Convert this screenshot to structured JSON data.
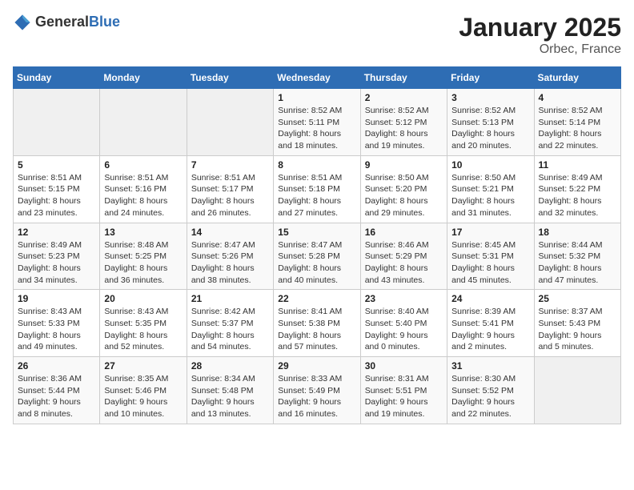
{
  "header": {
    "logo": {
      "general": "General",
      "blue": "Blue"
    },
    "title": "January 2025",
    "subtitle": "Orbec, France"
  },
  "calendar": {
    "days_of_week": [
      "Sunday",
      "Monday",
      "Tuesday",
      "Wednesday",
      "Thursday",
      "Friday",
      "Saturday"
    ],
    "weeks": [
      [
        {
          "day": "",
          "info": ""
        },
        {
          "day": "",
          "info": ""
        },
        {
          "day": "",
          "info": ""
        },
        {
          "day": "1",
          "info": "Sunrise: 8:52 AM\nSunset: 5:11 PM\nDaylight: 8 hours and 18 minutes."
        },
        {
          "day": "2",
          "info": "Sunrise: 8:52 AM\nSunset: 5:12 PM\nDaylight: 8 hours and 19 minutes."
        },
        {
          "day": "3",
          "info": "Sunrise: 8:52 AM\nSunset: 5:13 PM\nDaylight: 8 hours and 20 minutes."
        },
        {
          "day": "4",
          "info": "Sunrise: 8:52 AM\nSunset: 5:14 PM\nDaylight: 8 hours and 22 minutes."
        }
      ],
      [
        {
          "day": "5",
          "info": "Sunrise: 8:51 AM\nSunset: 5:15 PM\nDaylight: 8 hours and 23 minutes."
        },
        {
          "day": "6",
          "info": "Sunrise: 8:51 AM\nSunset: 5:16 PM\nDaylight: 8 hours and 24 minutes."
        },
        {
          "day": "7",
          "info": "Sunrise: 8:51 AM\nSunset: 5:17 PM\nDaylight: 8 hours and 26 minutes."
        },
        {
          "day": "8",
          "info": "Sunrise: 8:51 AM\nSunset: 5:18 PM\nDaylight: 8 hours and 27 minutes."
        },
        {
          "day": "9",
          "info": "Sunrise: 8:50 AM\nSunset: 5:20 PM\nDaylight: 8 hours and 29 minutes."
        },
        {
          "day": "10",
          "info": "Sunrise: 8:50 AM\nSunset: 5:21 PM\nDaylight: 8 hours and 31 minutes."
        },
        {
          "day": "11",
          "info": "Sunrise: 8:49 AM\nSunset: 5:22 PM\nDaylight: 8 hours and 32 minutes."
        }
      ],
      [
        {
          "day": "12",
          "info": "Sunrise: 8:49 AM\nSunset: 5:23 PM\nDaylight: 8 hours and 34 minutes."
        },
        {
          "day": "13",
          "info": "Sunrise: 8:48 AM\nSunset: 5:25 PM\nDaylight: 8 hours and 36 minutes."
        },
        {
          "day": "14",
          "info": "Sunrise: 8:47 AM\nSunset: 5:26 PM\nDaylight: 8 hours and 38 minutes."
        },
        {
          "day": "15",
          "info": "Sunrise: 8:47 AM\nSunset: 5:28 PM\nDaylight: 8 hours and 40 minutes."
        },
        {
          "day": "16",
          "info": "Sunrise: 8:46 AM\nSunset: 5:29 PM\nDaylight: 8 hours and 43 minutes."
        },
        {
          "day": "17",
          "info": "Sunrise: 8:45 AM\nSunset: 5:31 PM\nDaylight: 8 hours and 45 minutes."
        },
        {
          "day": "18",
          "info": "Sunrise: 8:44 AM\nSunset: 5:32 PM\nDaylight: 8 hours and 47 minutes."
        }
      ],
      [
        {
          "day": "19",
          "info": "Sunrise: 8:43 AM\nSunset: 5:33 PM\nDaylight: 8 hours and 49 minutes."
        },
        {
          "day": "20",
          "info": "Sunrise: 8:43 AM\nSunset: 5:35 PM\nDaylight: 8 hours and 52 minutes."
        },
        {
          "day": "21",
          "info": "Sunrise: 8:42 AM\nSunset: 5:37 PM\nDaylight: 8 hours and 54 minutes."
        },
        {
          "day": "22",
          "info": "Sunrise: 8:41 AM\nSunset: 5:38 PM\nDaylight: 8 hours and 57 minutes."
        },
        {
          "day": "23",
          "info": "Sunrise: 8:40 AM\nSunset: 5:40 PM\nDaylight: 9 hours and 0 minutes."
        },
        {
          "day": "24",
          "info": "Sunrise: 8:39 AM\nSunset: 5:41 PM\nDaylight: 9 hours and 2 minutes."
        },
        {
          "day": "25",
          "info": "Sunrise: 8:37 AM\nSunset: 5:43 PM\nDaylight: 9 hours and 5 minutes."
        }
      ],
      [
        {
          "day": "26",
          "info": "Sunrise: 8:36 AM\nSunset: 5:44 PM\nDaylight: 9 hours and 8 minutes."
        },
        {
          "day": "27",
          "info": "Sunrise: 8:35 AM\nSunset: 5:46 PM\nDaylight: 9 hours and 10 minutes."
        },
        {
          "day": "28",
          "info": "Sunrise: 8:34 AM\nSunset: 5:48 PM\nDaylight: 9 hours and 13 minutes."
        },
        {
          "day": "29",
          "info": "Sunrise: 8:33 AM\nSunset: 5:49 PM\nDaylight: 9 hours and 16 minutes."
        },
        {
          "day": "30",
          "info": "Sunrise: 8:31 AM\nSunset: 5:51 PM\nDaylight: 9 hours and 19 minutes."
        },
        {
          "day": "31",
          "info": "Sunrise: 8:30 AM\nSunset: 5:52 PM\nDaylight: 9 hours and 22 minutes."
        },
        {
          "day": "",
          "info": ""
        }
      ]
    ]
  }
}
